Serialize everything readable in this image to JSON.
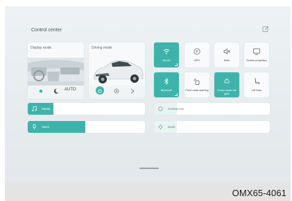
{
  "header": {
    "title": "Control center"
  },
  "display_card": {
    "label": "Display mode",
    "auto_label": "AUTO"
  },
  "driving_card": {
    "label": "Driving mode"
  },
  "tiles": [
    {
      "label": "WLAN",
      "icon": "wifi-icon",
      "active": true
    },
    {
      "label": "APH",
      "icon": "aph-icon",
      "active": false
    },
    {
      "label": "Mute",
      "icon": "mute-icon",
      "active": false
    },
    {
      "label": "Screen projection",
      "icon": "screen-projection-icon",
      "active": false
    },
    {
      "label": "Bluetooth",
      "icon": "bluetooth-icon",
      "active": true
    },
    {
      "label": "Front radar warning",
      "icon": "front-radar-icon",
      "active": false
    },
    {
      "label": "Power driver tail gate",
      "icon": "tailgate-icon",
      "active": true
    },
    {
      "label": "Lift Hom",
      "icon": "seat-icon",
      "active": false
    }
  ],
  "sliders": {
    "media": {
      "label": "Media",
      "level": 0.22
    },
    "voice": {
      "label": "Voice",
      "level": 0.49
    },
    "central_control": {
      "label": "Central con",
      "level": 0.2
    },
    "dash": {
      "label": "Dash",
      "level": 0.2
    }
  },
  "reference_code": "OMX65-4061",
  "colors": {
    "accent": "#3fb3ab",
    "background": "#e7ecef"
  }
}
